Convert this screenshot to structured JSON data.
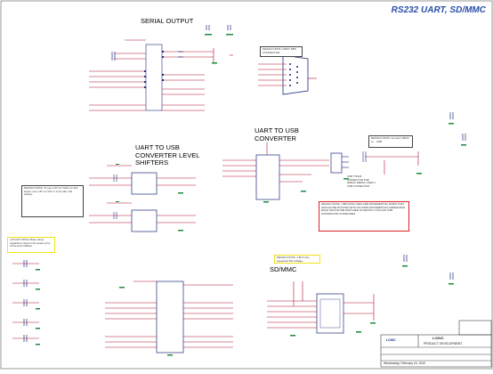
{
  "sheet": {
    "title": "RS232 UART, SD/MMC",
    "sections": {
      "serial_output": "SERIAL OUTPUT",
      "uart_usb_shifters": [
        "UART TO USB",
        "CONVERTER LEVEL",
        "SHIFTERS"
      ],
      "uart_usb_converter": [
        "UART TO USB",
        "CONVERTER"
      ],
      "sd_mmc": "SD/MMC"
    }
  },
  "colors": {
    "title": "#2a4fa8",
    "wire": "#b0102a",
    "component": "#1d2a7a",
    "green": "#1e8a3c",
    "note_red": "#dd2222",
    "note_yellow": "#f2e11b"
  },
  "notes": {
    "shifter_note": "DESIGN NOTE: To use 3.3V for VADJ on this board, use 1.8V on VIO or 3.3V with VIO setting...",
    "usb_diff_note": "DESIGN NOTE: USB DATA LINES ARE DIFFERENTIAL PAIRS THAT SHOULD BE ROUTED WITH 90 OHMS DIFFERENTIAL IMPEDANCE. EACH SHOULD BE MATCHED IN LENGTH. FOLLOW USB CONNECTOR GUIDELINES.",
    "sd_note": "DESIGN NOTE: 1.8V is the supported SD voltage...",
    "level_note": "LAYOUT NOTE: Place these capacitors close to the power pins of the level shifters.",
    "db9_note": "DESIGN NOTE: FIRST DB9 CONNECTOR",
    "usb_led_note": "DESIGN NOTE: Connect VBUS to... USB",
    "usb_conn_note": "USB TYPE B CONNECTOR FOR DEBUG SERIAL OVER A USB CONNECTION"
  },
  "title_block": {
    "company": "LOGIC",
    "department": "PRODUCT DEVELOPMENT",
    "date": "Wednesday, February 24, 2010",
    "logo_text": "LOGIC"
  }
}
